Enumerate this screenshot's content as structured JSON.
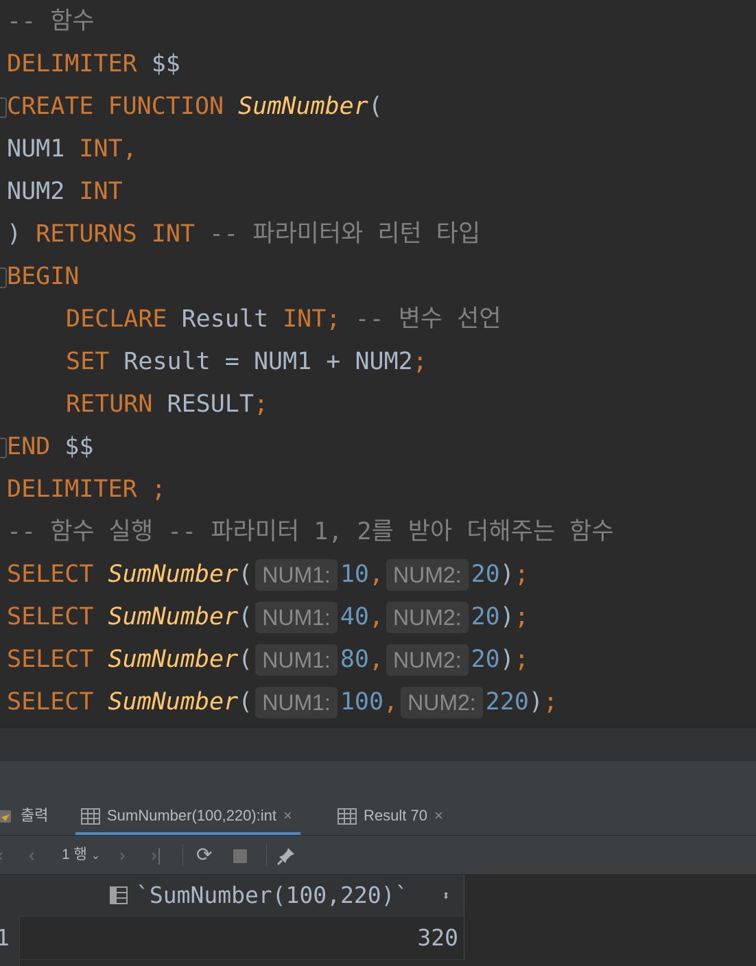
{
  "editor": {
    "l0": {
      "comment": "-- 함수"
    },
    "l1": {
      "kw": "DELIMITER",
      "rest": " $$"
    },
    "l2": {
      "kw1": "CREATE",
      "kw2": "FUNCTION",
      "fn": "SumNumber",
      "paren": "("
    },
    "l3": {
      "id": "NUM1",
      "kw": "INT,"
    },
    "l4": {
      "id": "NUM2",
      "kw": "INT"
    },
    "l5": {
      "paren": ")",
      "kw1": "RETURNS",
      "kw2": "INT",
      "comment": "-- 파라미터와 리턴 타입"
    },
    "l6": {
      "kw": "BEGIN"
    },
    "l7": {
      "kw1": "DECLARE",
      "id": "Result",
      "kw2": "INT;",
      "comment": "-- 변수 선언"
    },
    "l8": {
      "kw": "SET",
      "expr": "Result = NUM1 + NUM2",
      "semi": ";"
    },
    "l9": {
      "kw": "RETURN",
      "id": "RESULT",
      "semi": ";"
    },
    "l10": {
      "kw": "END",
      "rest": " $$"
    },
    "l11": {
      "kw": "DELIMITER ;"
    },
    "l12": {
      "comment": "-- 함수 실행 -- 파라미터 1, 2를 받아 더해주는 함수"
    },
    "calls": [
      {
        "kw": "SELECT",
        "fn": "SumNumber",
        "hint1": "NUM1:",
        "a": "10",
        "hint2": "NUM2:",
        "b": "20"
      },
      {
        "kw": "SELECT",
        "fn": "SumNumber",
        "hint1": "NUM1:",
        "a": "40",
        "hint2": "NUM2:",
        "b": "20"
      },
      {
        "kw": "SELECT",
        "fn": "SumNumber",
        "hint1": "NUM1:",
        "a": "80",
        "hint2": "NUM2:",
        "b": "20"
      },
      {
        "kw": "SELECT",
        "fn": "SumNumber",
        "hint1": "NUM1:",
        "a": "100",
        "hint2": "NUM2:",
        "b": "220"
      }
    ]
  },
  "tabs": {
    "output": "출력",
    "result1": "SumNumber(100,220):int",
    "result2": "Result 70",
    "close_glyph": "×"
  },
  "toolbar": {
    "row_label": "1 행"
  },
  "grid": {
    "column_header": "`SumNumber(100,220)`",
    "sort_glyph": "⬍",
    "row_number": "1",
    "value": "320"
  },
  "colors": {
    "keyword": "#cc7832",
    "function": "#ffc66d",
    "comment": "#808080",
    "number": "#6897bb",
    "identifier": "#a9b7c6",
    "accent": "#4a88c7"
  }
}
